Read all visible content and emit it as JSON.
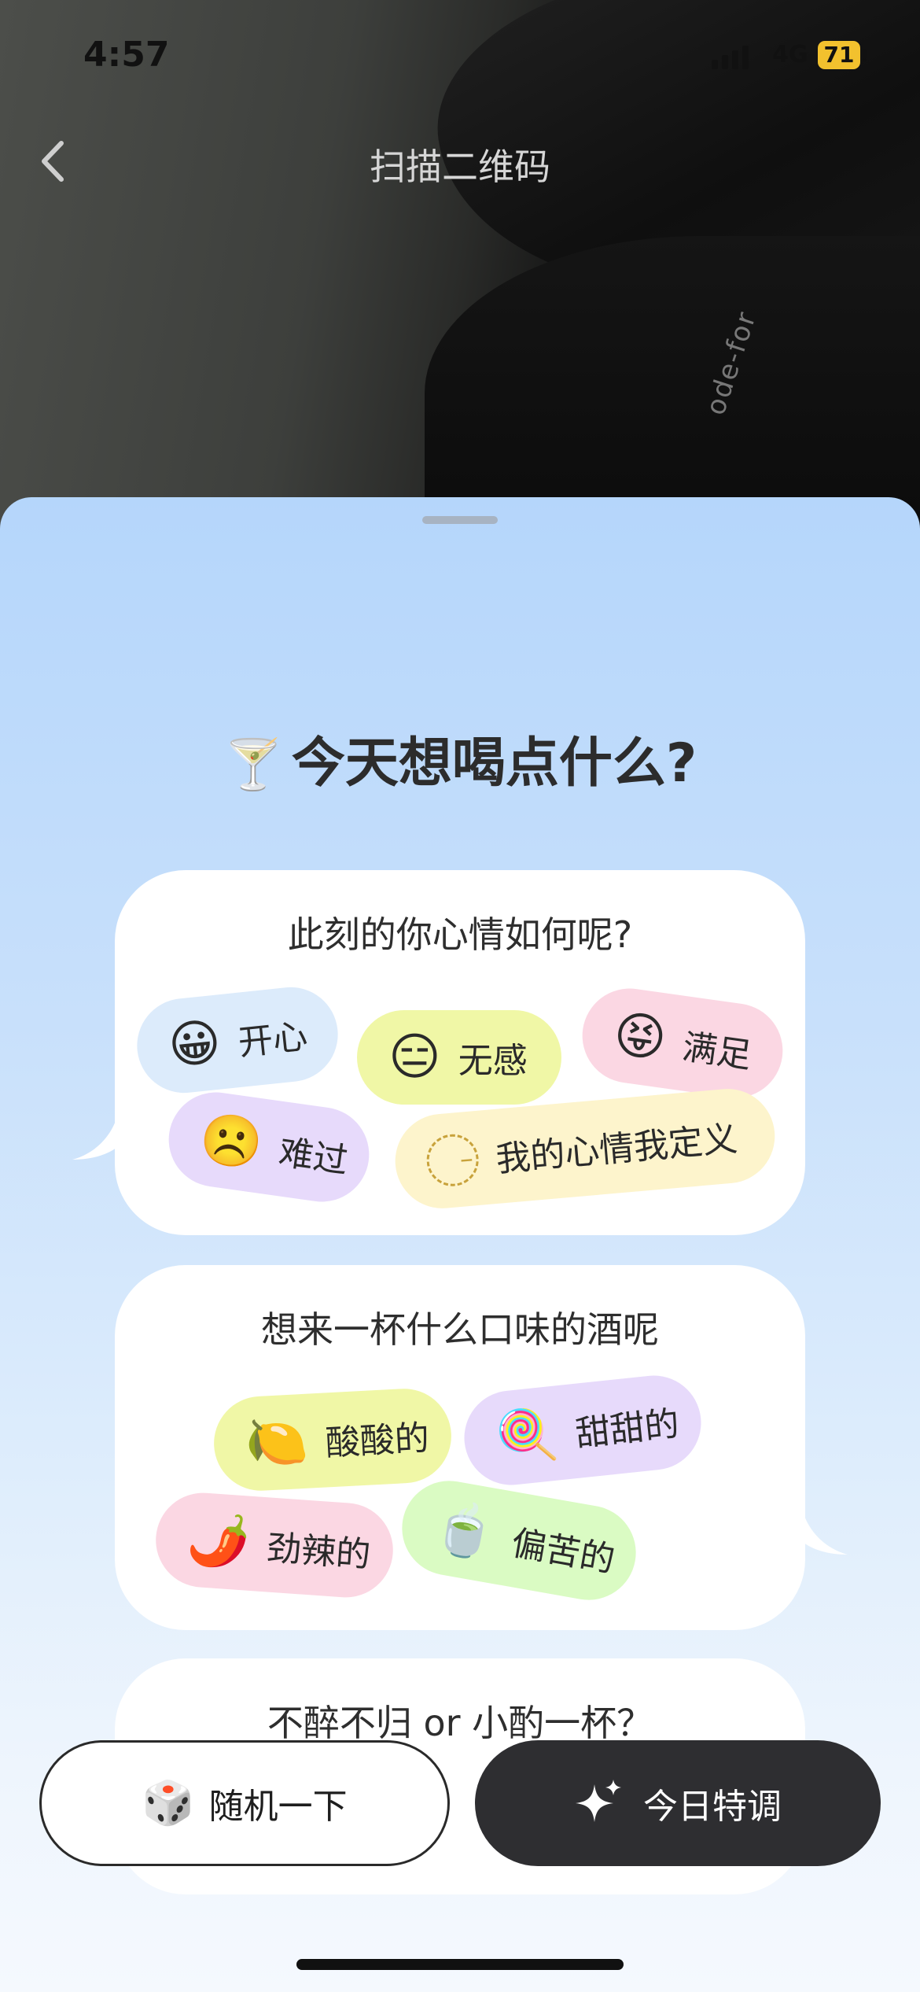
{
  "status_bar": {
    "time": "4:57",
    "network": "4G",
    "battery": "71"
  },
  "nav": {
    "title": "扫描二维码"
  },
  "camera": {
    "print_text": "ode-for"
  },
  "sheet": {
    "heading_emoji": "🍸",
    "heading": "今天想喝点什么?",
    "mood_card": {
      "title": "此刻的你心情如何呢?",
      "chips": [
        {
          "emoji": "😀",
          "label": "开心"
        },
        {
          "emoji": "😑",
          "label": "无感"
        },
        {
          "emoji": "😝",
          "label": "满足"
        },
        {
          "emoji": "☹️",
          "label": "难过"
        },
        {
          "emoji": "😐",
          "label": "我的心情我定义"
        }
      ]
    },
    "flavor_card": {
      "title": "想来一杯什么口味的酒呢",
      "chips": [
        {
          "emoji": "🍋",
          "label": "酸酸的"
        },
        {
          "emoji": "🍭",
          "label": "甜甜的"
        },
        {
          "emoji": "🌶️",
          "label": "劲辣的"
        },
        {
          "emoji": "🍵",
          "label": "偏苦的"
        }
      ]
    },
    "strength_card": {
      "title": "不醉不归 or 小酌一杯？"
    }
  },
  "buttons": {
    "random": {
      "emoji": "🎲",
      "label": "随机一下"
    },
    "special": {
      "icon": "sparkles-icon",
      "label": "今日特调"
    }
  }
}
